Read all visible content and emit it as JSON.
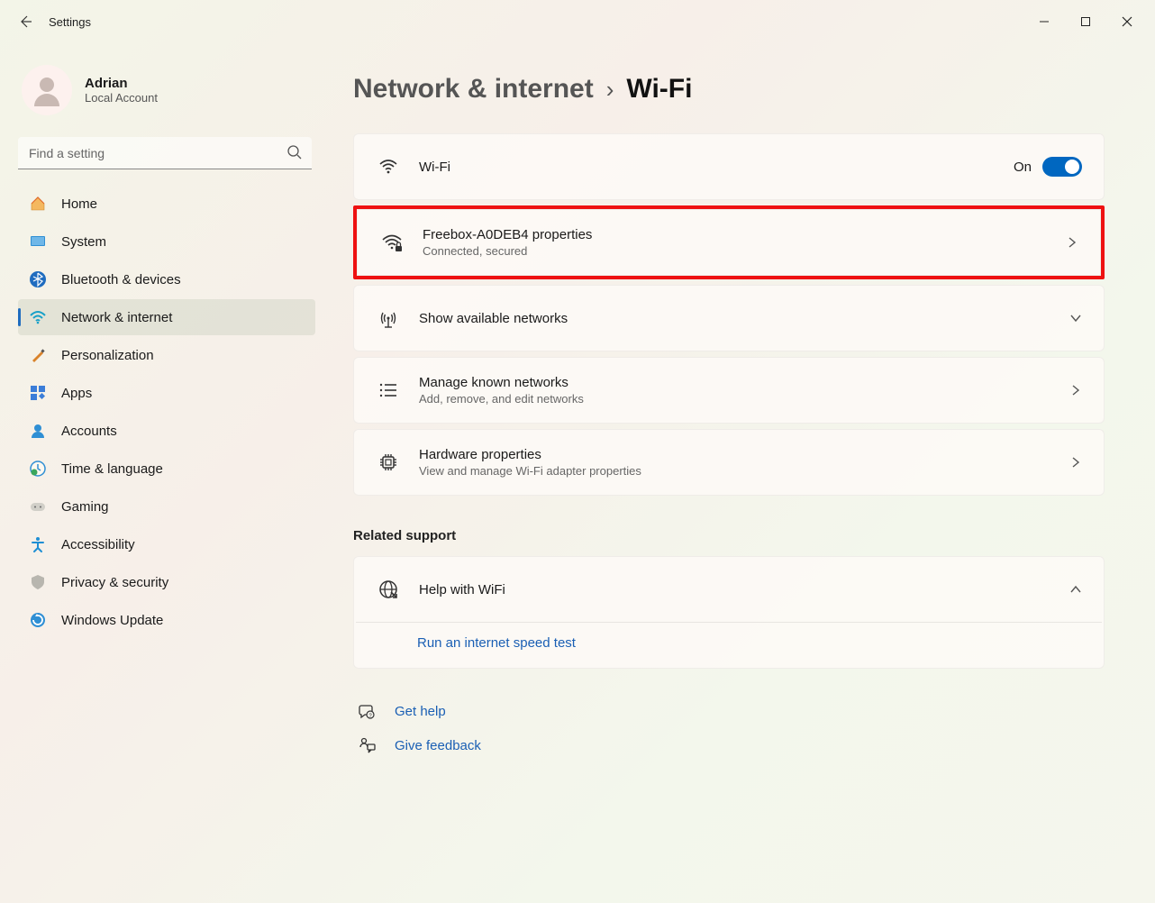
{
  "window": {
    "title": "Settings"
  },
  "user": {
    "name": "Adrian",
    "sub": "Local Account"
  },
  "search": {
    "placeholder": "Find a setting"
  },
  "nav": {
    "items": [
      {
        "label": "Home"
      },
      {
        "label": "System"
      },
      {
        "label": "Bluetooth & devices"
      },
      {
        "label": "Network & internet"
      },
      {
        "label": "Personalization"
      },
      {
        "label": "Apps"
      },
      {
        "label": "Accounts"
      },
      {
        "label": "Time & language"
      },
      {
        "label": "Gaming"
      },
      {
        "label": "Accessibility"
      },
      {
        "label": "Privacy & security"
      },
      {
        "label": "Windows Update"
      }
    ]
  },
  "breadcrumb": {
    "parent": "Network & internet",
    "current": "Wi-Fi"
  },
  "wifi_toggle": {
    "title": "Wi-Fi",
    "state": "On"
  },
  "connected": {
    "title": "Freebox-A0DEB4 properties",
    "sub": "Connected, secured"
  },
  "available": {
    "title": "Show available networks"
  },
  "known": {
    "title": "Manage known networks",
    "sub": "Add, remove, and edit networks"
  },
  "hardware": {
    "title": "Hardware properties",
    "sub": "View and manage Wi-Fi adapter properties"
  },
  "related": {
    "heading": "Related support",
    "help_title": "Help with WiFi",
    "speed_link": "Run an internet speed test"
  },
  "links": {
    "get_help": "Get help",
    "feedback": "Give feedback"
  }
}
